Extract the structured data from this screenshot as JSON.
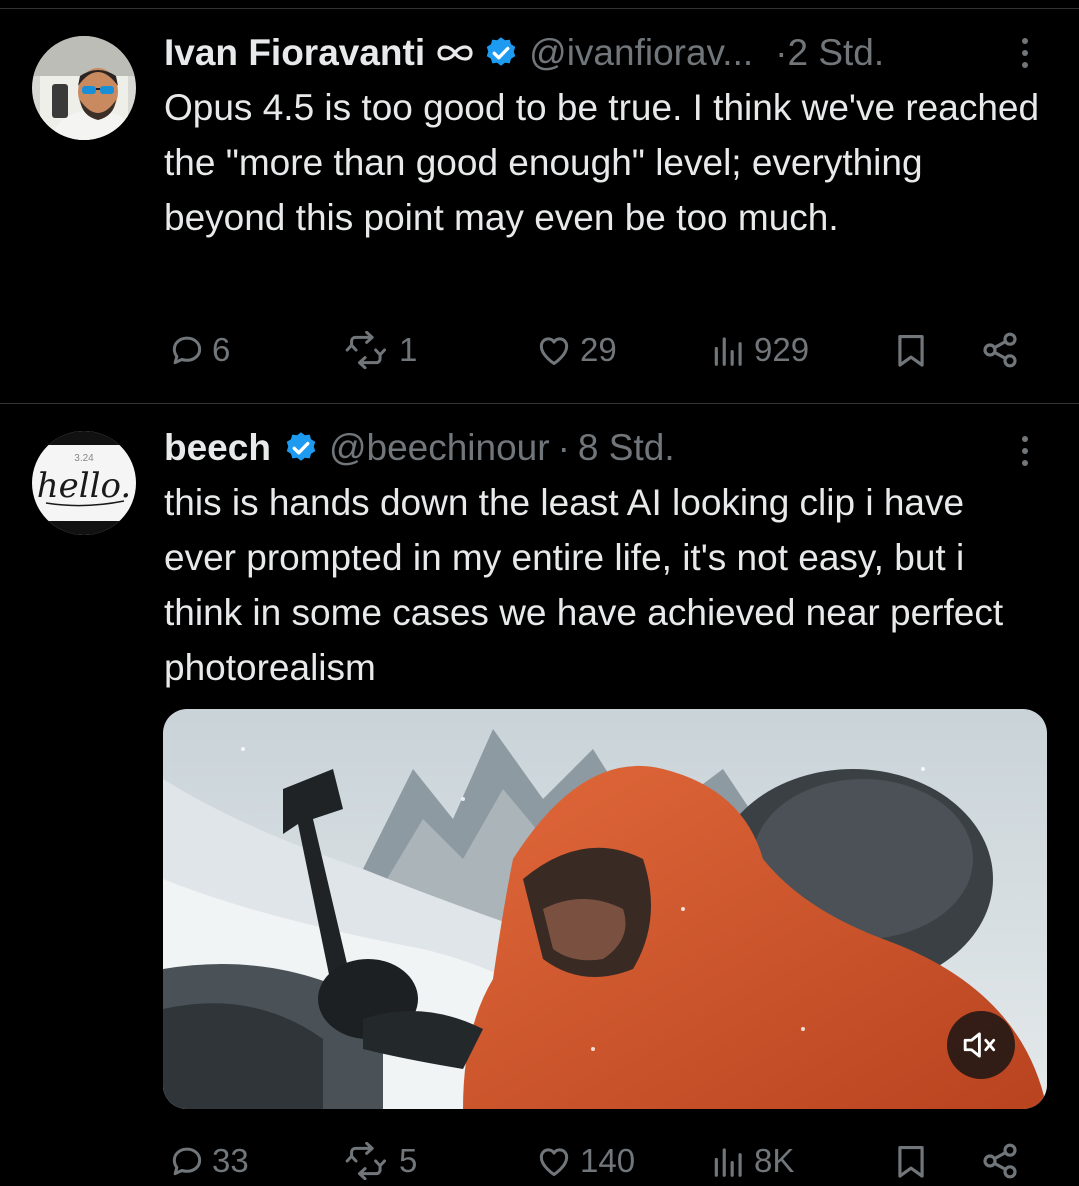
{
  "tweets": [
    {
      "author_name": "Ivan Fioravanti",
      "handle": "@ivanfiorav...",
      "separator": "·",
      "time": "2 Std.",
      "text": "Opus 4.5 is too good to be true. I think we've reached the \"more than good enough\" level; everything beyond this point may even be too much.",
      "stats": {
        "replies": "6",
        "reposts": "1",
        "likes": "29",
        "views": "929"
      },
      "verified": true,
      "affiliate_icon": "infinity-icon"
    },
    {
      "author_name": "beech",
      "handle": "@beechinour",
      "separator": "·",
      "time": "8 Std.",
      "avatar_text": "hello.",
      "avatar_small_text": "3.24",
      "text": "this is hands down the least AI looking clip i have ever prompted in my entire life, it's not easy, but i think in some cases we have achieved near perfect photorealism",
      "stats": {
        "replies": "33",
        "reposts": "5",
        "likes": "140",
        "views": "8K"
      },
      "verified": true,
      "media": {
        "kind": "video",
        "description_icon": "mute-icon"
      }
    }
  ],
  "colors": {
    "background": "#000000",
    "text": "#e7e9ea",
    "secondary": "#71767b",
    "verified": "#1d9bf0",
    "divider": "#2f3336"
  }
}
